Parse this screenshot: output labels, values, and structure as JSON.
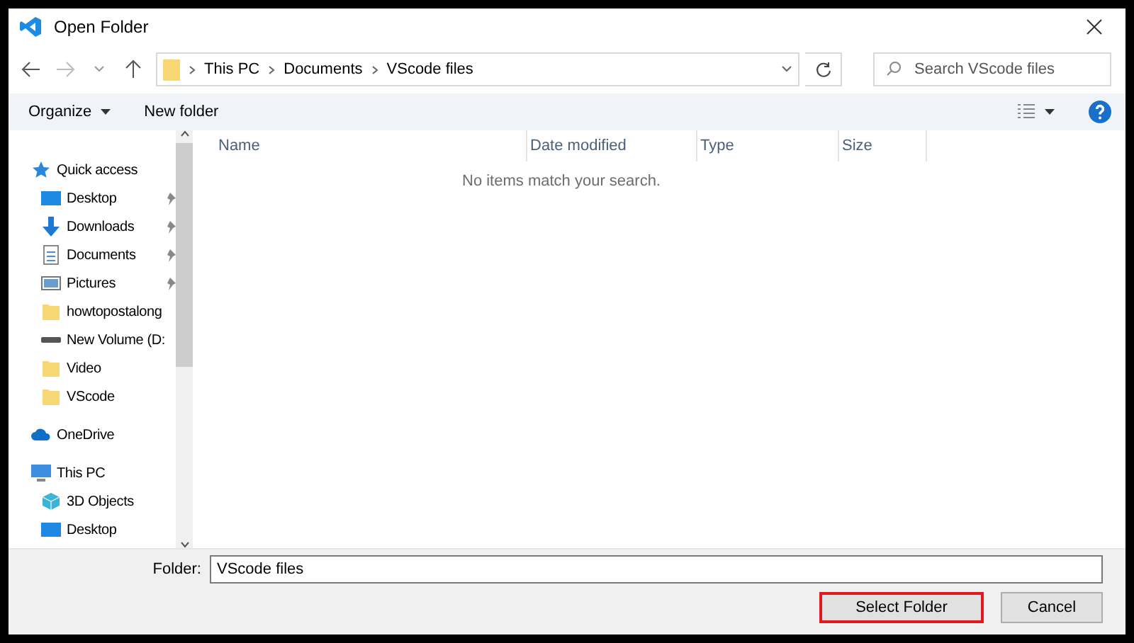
{
  "window": {
    "title": "Open Folder"
  },
  "address_bar": {
    "crumbs": [
      "This PC",
      "Documents",
      "VScode files"
    ]
  },
  "search": {
    "placeholder": "Search VScode files"
  },
  "toolbar": {
    "organize": "Organize",
    "new_folder": "New folder"
  },
  "sidebar": {
    "items": [
      {
        "label": "Quick access",
        "kind": "star",
        "pinned": false,
        "indent": false
      },
      {
        "label": "Desktop",
        "kind": "desktop",
        "pinned": true,
        "indent": true
      },
      {
        "label": "Downloads",
        "kind": "download",
        "pinned": true,
        "indent": true
      },
      {
        "label": "Documents",
        "kind": "document",
        "pinned": true,
        "indent": true
      },
      {
        "label": "Pictures",
        "kind": "picture",
        "pinned": true,
        "indent": true
      },
      {
        "label": "howtopostalong",
        "kind": "folder",
        "pinned": false,
        "indent": true
      },
      {
        "label": "New Volume (D:",
        "kind": "drive",
        "pinned": false,
        "indent": true
      },
      {
        "label": "Video",
        "kind": "folder",
        "pinned": false,
        "indent": true
      },
      {
        "label": "VScode",
        "kind": "folder",
        "pinned": false,
        "indent": true
      },
      {
        "label": "OneDrive",
        "kind": "cloud",
        "pinned": false,
        "indent": false
      },
      {
        "label": "This PC",
        "kind": "pc",
        "pinned": false,
        "indent": false
      },
      {
        "label": "3D Objects",
        "kind": "cube",
        "pinned": false,
        "indent": true
      },
      {
        "label": "Desktop",
        "kind": "desktop",
        "pinned": false,
        "indent": true
      }
    ]
  },
  "table": {
    "columns": [
      "Name",
      "Date modified",
      "Type",
      "Size"
    ],
    "empty_message": "No items match your search."
  },
  "folder_field": {
    "label": "Folder:",
    "value": "VScode files"
  },
  "buttons": [
    {
      "label": "Select Folder",
      "highlighted": true
    },
    {
      "label": "Cancel",
      "highlighted": false
    }
  ]
}
